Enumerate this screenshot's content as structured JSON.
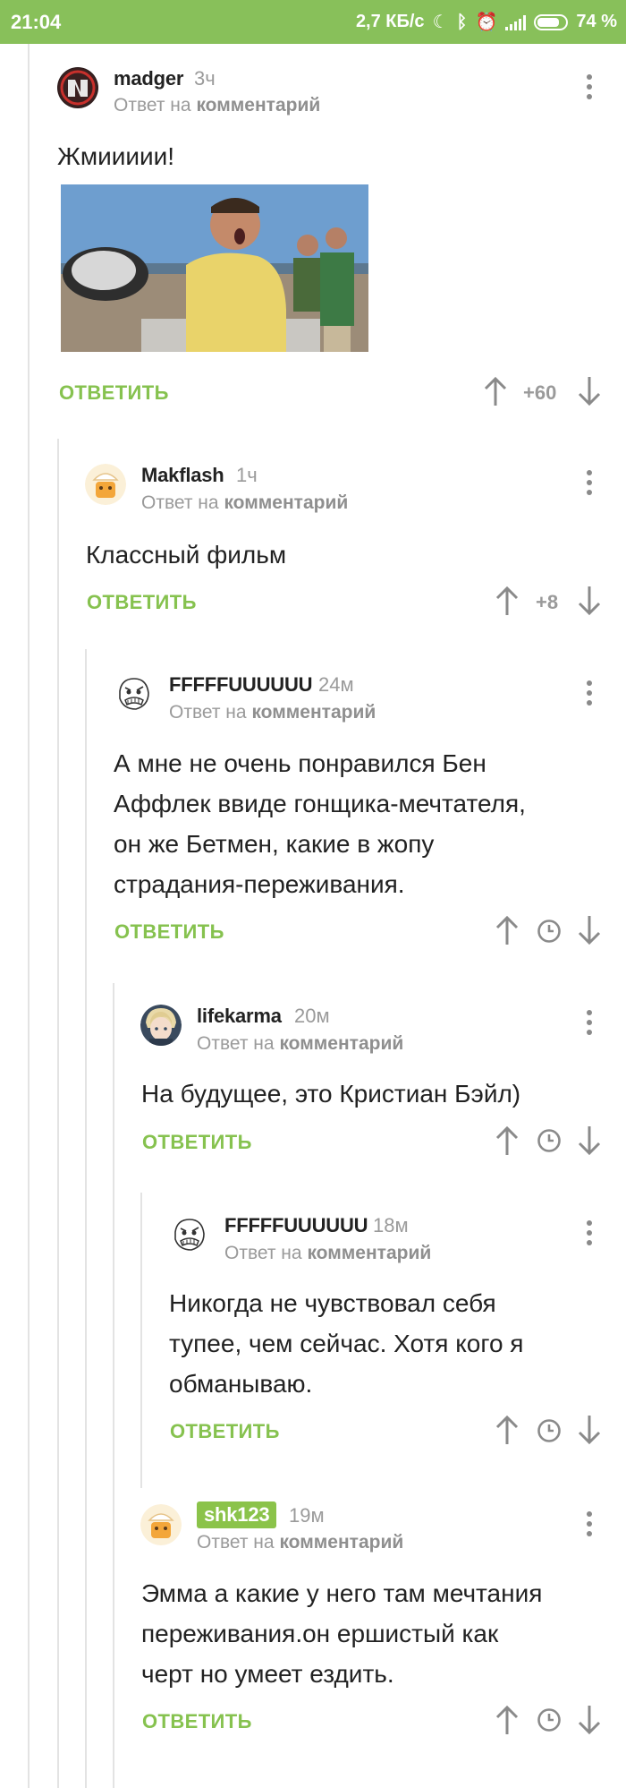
{
  "status_bar": {
    "time": "21:04",
    "speed": "2,7 КБ/с",
    "battery": "74 %",
    "icons": [
      "moon-icon",
      "bluetooth-icon",
      "alarm-icon",
      "signal-icon",
      "battery-icon"
    ]
  },
  "colors": {
    "status_bar": "#88c05a",
    "accent": "#86c24f",
    "muted": "#9a9a9a"
  },
  "reply_label": "ОТВЕТИТЬ",
  "reply_to_prefix": "Ответ на",
  "reply_to_target": "комментарий",
  "comments": [
    {
      "user": "madger",
      "time": "3ч",
      "text": "Жмиииии!",
      "has_image": true,
      "image_alt": "man in yellow shirt with open mouth holding a helmet",
      "score": "+60"
    },
    {
      "user": "Makflash",
      "time": "1ч",
      "text": "Классный фильм",
      "score": "+8"
    },
    {
      "user": "FFFFFUUUUUU",
      "time": "24м",
      "text_lines": [
        "А мне не очень понравился Бен",
        "Аффлек ввиде гонщика-мечтателя,",
        "он же Бетмен, какие в жопу",
        "страдания-переживания."
      ],
      "score": null
    },
    {
      "user": "lifekarma",
      "time": "20м",
      "text": "На будущее, это Кристиан Бэйл)",
      "score": null
    },
    {
      "user": "FFFFFUUUUUU",
      "time": "18м",
      "text_lines": [
        "Никогда не чувствовал себя",
        "тупее, чем сейчас. Хотя кого я",
        "обманываю."
      ],
      "score": null
    },
    {
      "user": "shk123",
      "time": "19м",
      "text_lines": [
        "Эмма а какие у него там мечтания",
        "переживания.он ершистый как",
        "черт но умеет ездить."
      ],
      "score": null
    }
  ]
}
